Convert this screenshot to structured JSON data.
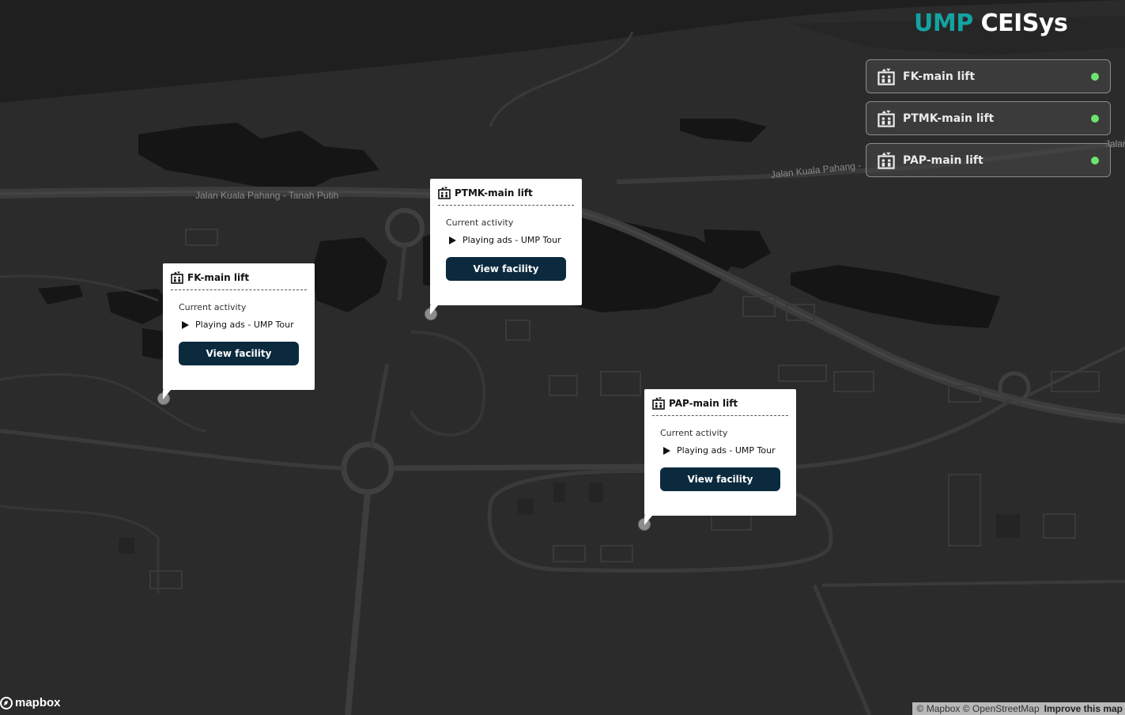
{
  "brand": {
    "part1": "UMP",
    "part2": "CEISys"
  },
  "lift_list": [
    {
      "name": "FK-main lift",
      "status_color": "#6ee36e"
    },
    {
      "name": "PTMK-main lift",
      "status_color": "#6ee36e"
    },
    {
      "name": "PAP-main lift",
      "status_color": "#6ee36e"
    }
  ],
  "popups": [
    {
      "title": "FK-main lift",
      "activity_label": "Current activity",
      "activity": "Playing ads - UMP Tour",
      "button": "View facility"
    },
    {
      "title": "PTMK-main lift",
      "activity_label": "Current activity",
      "activity": "Playing ads - UMP Tour",
      "button": "View facility"
    },
    {
      "title": "PAP-main lift",
      "activity_label": "Current activity",
      "activity": "Playing ads - UMP Tour",
      "button": "View facility"
    }
  ],
  "road_labels": {
    "left": "Jalan Kuala Pahang - Tanah Putih",
    "right": "Jalan Kuala Pahang -",
    "edge": "Jalan"
  },
  "footer": {
    "logo": "mapbox",
    "attribution": "© Mapbox © OpenStreetMap",
    "improve": "Improve this map"
  },
  "icons": {
    "lift": "elevator-icon",
    "play": "play-icon",
    "status": "status-dot"
  }
}
